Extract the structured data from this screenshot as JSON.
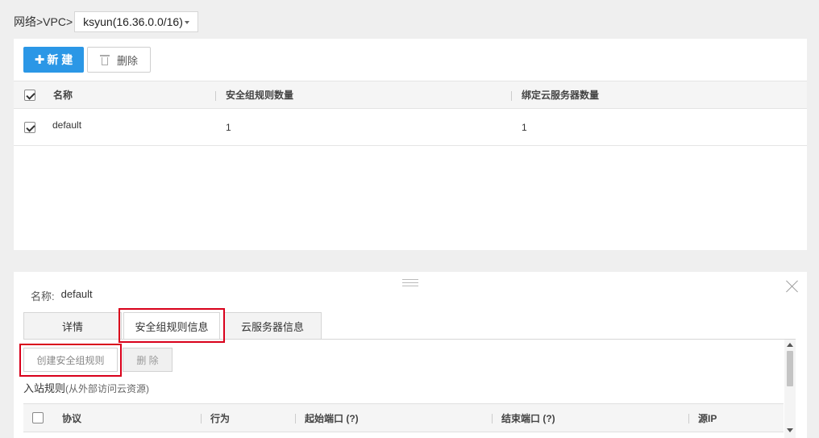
{
  "breadcrumb": {
    "path": "网络>VPC>",
    "vpc_selected": "ksyun(16.36.0.0/16)"
  },
  "toolbar": {
    "new_label": "新 建",
    "delete_label": "删除"
  },
  "security_groups_table": {
    "columns": [
      "名称",
      "安全组规则数量",
      "绑定云服务器数量"
    ],
    "rows": [
      {
        "name": "default",
        "rule_count": "1",
        "server_count": "1",
        "checked": true
      }
    ]
  },
  "detail": {
    "name_label": "名称:",
    "name_value": "default",
    "tabs": [
      {
        "label": "详情"
      },
      {
        "label": "安全组规则信息",
        "active": true
      },
      {
        "label": "云服务器信息"
      }
    ],
    "create_rule_label": "创建安全组规则",
    "delete_rule_label": "删 除",
    "inbound_title": "入站规则",
    "inbound_subtitle": "(从外部访问云资源)",
    "rule_columns": [
      "协议",
      "行为",
      "起始端口 (?)",
      "结束端口 (?)",
      "源IP"
    ]
  },
  "colors": {
    "primary_button": "#2b97e6",
    "highlight_box": "#d9001b"
  }
}
